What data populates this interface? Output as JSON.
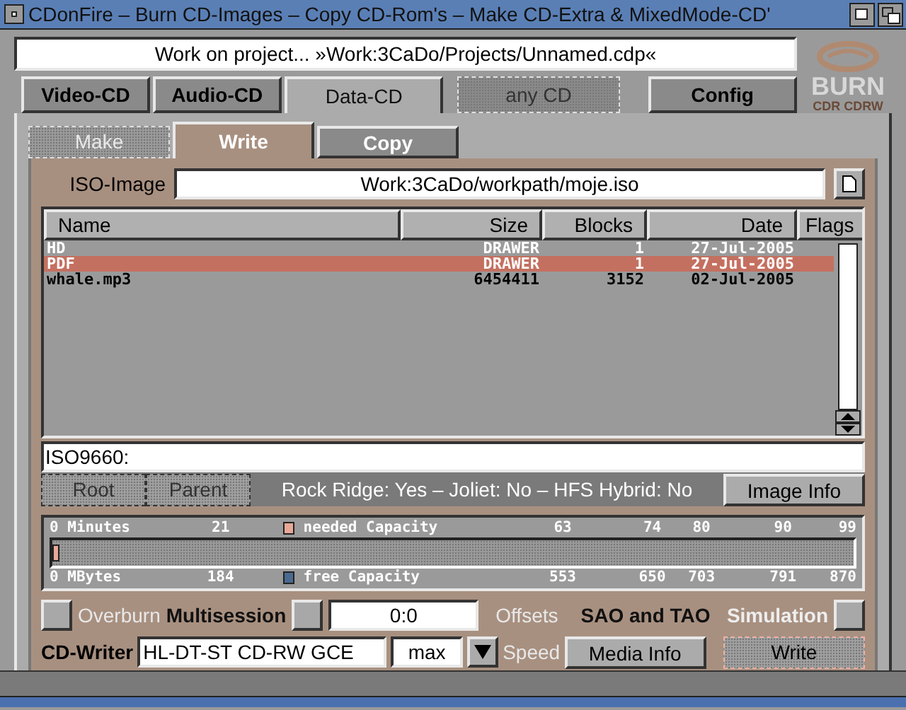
{
  "window": {
    "title": "CDonFire – Burn CD-Images – Copy CD-Rom's – Make CD-Extra & MixedMode-CD'"
  },
  "project": "Work on project... »Work:3CaDo/Projects/Unnamed.cdp«",
  "logo": {
    "title": "BURN",
    "subtitle": "CDR CDRW"
  },
  "tabs": [
    {
      "label": "Video-CD",
      "selected": false,
      "disabled": false
    },
    {
      "label": "Audio-CD",
      "selected": false,
      "disabled": false
    },
    {
      "label": "Data-CD",
      "selected": true,
      "disabled": false
    },
    {
      "label": "any CD",
      "selected": false,
      "disabled": true
    },
    {
      "label": "Config",
      "selected": false,
      "disabled": false
    }
  ],
  "subtabs": [
    {
      "label": "Make",
      "selected": false,
      "disabled": true
    },
    {
      "label": "Write",
      "selected": true,
      "disabled": false
    },
    {
      "label": "Copy",
      "selected": false,
      "disabled": false
    }
  ],
  "iso_image": {
    "label": "ISO-Image",
    "value": "Work:3CaDo/workpath/moje.iso"
  },
  "table": {
    "columns": [
      "Name",
      "Size",
      "Blocks",
      "Date",
      "Flags"
    ],
    "rows": [
      {
        "kind": "drawer",
        "selected": false,
        "cells": [
          "HD",
          "DRAWER",
          "1",
          "27-Jul-2005"
        ]
      },
      {
        "kind": "drawer",
        "selected": true,
        "cells": [
          "PDF",
          "DRAWER",
          "1",
          "27-Jul-2005"
        ]
      },
      {
        "kind": "file",
        "selected": false,
        "cells": [
          "whale.mp3",
          "6454411",
          "3152",
          "02-Jul-2005"
        ]
      }
    ]
  },
  "path": "ISO9660:",
  "nav_buttons": [
    {
      "label": "Root",
      "disabled": true
    },
    {
      "label": "Parent",
      "disabled": true
    }
  ],
  "image_flags": "Rock Ridge: Yes – Joliet: No – HFS Hybrid: No",
  "image_info_button": "Image Info",
  "capacity": {
    "level": 0.006,
    "minutes": [
      "0 Minutes",
      "21",
      "63",
      "74",
      "80",
      "90",
      "99"
    ],
    "mbytes": [
      "0 MBytes",
      "184",
      "553",
      "650",
      "703",
      "791",
      "870"
    ],
    "legend": [
      {
        "label": "needed Capacity",
        "color": "#e8a898"
      },
      {
        "label": "free Capacity",
        "color": "#4a6a90"
      }
    ]
  },
  "options": {
    "overburn": {
      "label": "Overburn",
      "checked": false
    },
    "multisession": {
      "label": "Multisession",
      "checked": false
    },
    "offsets": {
      "value": "0:0",
      "label": "Offsets"
    },
    "mode": "SAO and TAO",
    "simulation": {
      "label": "Simulation",
      "checked": false
    }
  },
  "writer": {
    "label": "CD-Writer",
    "device": "HL-DT-ST CD-RW GCE",
    "speed": "max",
    "speed_label": "Speed"
  },
  "buttons": {
    "media_info": "Media Info",
    "write": "Write"
  }
}
